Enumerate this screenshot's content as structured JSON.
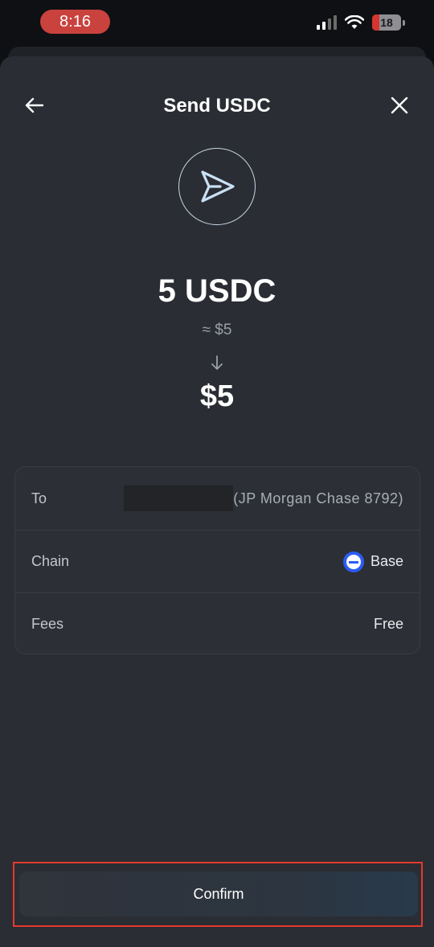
{
  "status_bar": {
    "time": "8:16",
    "battery": "18"
  },
  "header": {
    "title": "Send USDC"
  },
  "amount": {
    "crypto": "5 USDC",
    "approx": "≈ $5",
    "fiat": "$5"
  },
  "details": {
    "to": {
      "label": "To",
      "value": "(JP Morgan Chase 8792)"
    },
    "chain": {
      "label": "Chain",
      "value": "Base"
    },
    "fees": {
      "label": "Fees",
      "value": "Free"
    }
  },
  "confirm": {
    "label": "Confirm"
  },
  "colors": {
    "accent_highlight": "#e5392e",
    "base_blue": "#2b5cf6",
    "sheet_bg": "#2a2d33"
  }
}
